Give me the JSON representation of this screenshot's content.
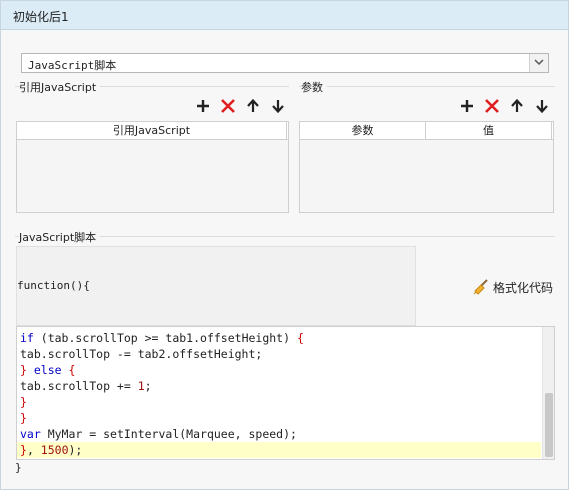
{
  "window": {
    "title": "初始化后1"
  },
  "script_select": {
    "value": "JavaScript脚本"
  },
  "ref_js": {
    "group_label": "引用JavaScript",
    "column": "引用JavaScript"
  },
  "params": {
    "group_label": "参数",
    "columns": [
      "参数",
      "值"
    ]
  },
  "toolbar_icons": [
    "add-icon",
    "delete-icon",
    "move-up-icon",
    "move-down-icon"
  ],
  "script": {
    "group_label": "JavaScript脚本",
    "function_open": "function(){",
    "function_close": "}",
    "format_button": "格式化代码",
    "lines": [
      [
        [
          "kw",
          "if"
        ],
        [
          "id",
          " (tab.scrollTop >= tab1.offsetHeight) "
        ],
        [
          "br",
          "{"
        ]
      ],
      [
        [
          "id",
          "tab.scrollTop -= tab2.offsetHeight;"
        ]
      ],
      [
        [
          "br",
          "}"
        ],
        [
          "id",
          " "
        ],
        [
          "kw",
          "else"
        ],
        [
          "id",
          " "
        ],
        [
          "br",
          "{"
        ]
      ],
      [
        [
          "id",
          "tab.scrollTop += "
        ],
        [
          "num",
          "1"
        ],
        [
          "id",
          ";"
        ]
      ],
      [
        [
          "br",
          "}"
        ]
      ],
      [
        [
          "br",
          "}"
        ]
      ],
      [
        [
          "kw",
          "var"
        ],
        [
          "id",
          " MyMar = setInterval(Marquee, speed);"
        ]
      ],
      [
        [
          "br",
          "}"
        ],
        [
          "id",
          ", "
        ],
        [
          "num",
          "1500"
        ],
        [
          "id",
          ");"
        ]
      ]
    ],
    "highlighted_line": 8
  },
  "colors": {
    "titlebar": "#dbecf7",
    "highlight": "#ffff99",
    "keyword": "#0000cc",
    "bracket": "#cc0000"
  }
}
